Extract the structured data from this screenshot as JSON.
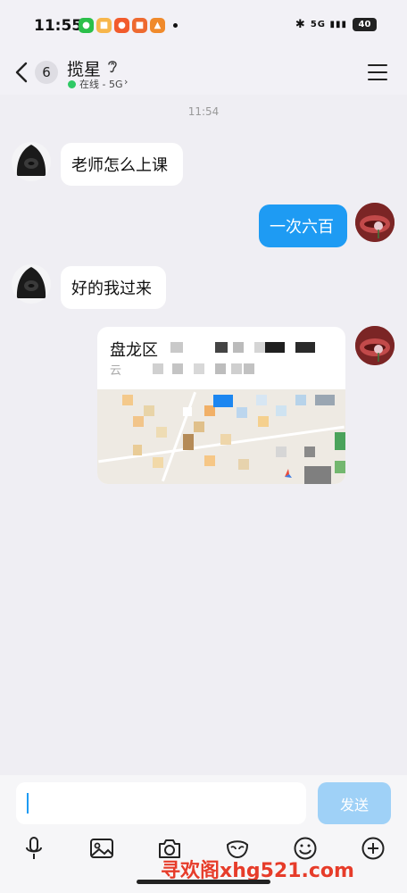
{
  "status_bar": {
    "time": "11:55",
    "network": "5G",
    "battery": "40",
    "notification_apps": [
      "wechat-icon",
      "taobao-icon",
      "weibo-icon",
      "app-icon",
      "app-icon"
    ]
  },
  "header": {
    "back_badge": "6",
    "title": "揽星",
    "status_text": "在线 - 5G",
    "online_color": "#2fc965"
  },
  "chat": {
    "timestamp": "11:54",
    "messages": [
      {
        "side": "in",
        "text": "老师怎么上课"
      },
      {
        "side": "out",
        "text": "一次六百"
      },
      {
        "side": "in",
        "text": "好的我过来"
      }
    ],
    "location_card": {
      "title": "盘龙区",
      "subtitle": "云"
    }
  },
  "input": {
    "placeholder": "",
    "send_label": "发送"
  },
  "toolbar": [
    "mic-icon",
    "image-icon",
    "camera-icon",
    "mask-icon",
    "emoji-icon",
    "plus-icon"
  ],
  "watermark": "寻欢阁xhg521.com",
  "colors": {
    "accent": "#1e9bf3",
    "send_disabled": "#9fd1f7",
    "background": "#efeef3"
  }
}
